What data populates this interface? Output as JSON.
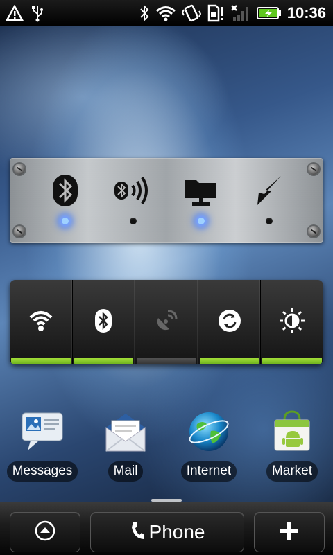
{
  "status_bar": {
    "time": "10:36",
    "icons": [
      "warning-icon",
      "usb-icon",
      "bluetooth-icon",
      "wifi-icon",
      "vibrate-icon",
      "sim-alert-icon",
      "no-signal-icon",
      "battery-charging-icon"
    ]
  },
  "settings_widget": {
    "items": [
      {
        "name": "bluetooth",
        "state": "on"
      },
      {
        "name": "bluetooth-discoverable",
        "state": "off"
      },
      {
        "name": "network-share",
        "state": "on"
      },
      {
        "name": "gps",
        "state": "off"
      }
    ],
    "led_on_color": "#4a8cff"
  },
  "power_control": {
    "accent": "#8cd12a",
    "buttons": [
      {
        "name": "wifi",
        "state": "on"
      },
      {
        "name": "bluetooth",
        "state": "on"
      },
      {
        "name": "gps",
        "state": "off"
      },
      {
        "name": "sync",
        "state": "on"
      },
      {
        "name": "brightness",
        "state": "on"
      }
    ]
  },
  "apps": [
    {
      "label": "Messages",
      "icon": "messages-icon"
    },
    {
      "label": "Mail",
      "icon": "mail-icon"
    },
    {
      "label": "Internet",
      "icon": "globe-icon"
    },
    {
      "label": "Market",
      "icon": "market-icon"
    }
  ],
  "dock": {
    "phone_label": "Phone",
    "left_icon": "app-drawer-icon",
    "right_icon": "add-icon"
  }
}
